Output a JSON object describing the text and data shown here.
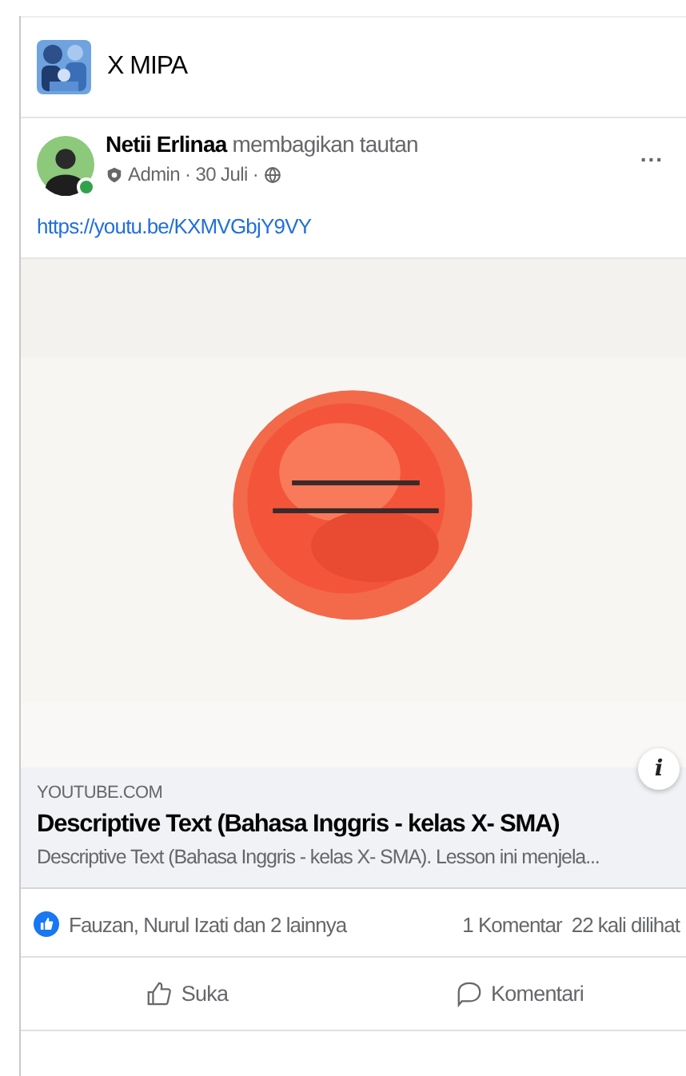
{
  "group": {
    "name": "X MIPA"
  },
  "post": {
    "author": "Netii Erlinaa",
    "action": "membagikan tautan",
    "role": "Admin",
    "date": "30 Juli",
    "separator": "·",
    "online": true,
    "more": "...",
    "link": "https://youtu.be/KXMVGbjY9VY"
  },
  "preview": {
    "domain": "YOUTUBE.COM",
    "title": "Descriptive Text (Bahasa Inggris - kelas X- SMA)",
    "description": "Descriptive Text (Bahasa Inggris - kelas X- SMA). Lesson ini menjela...",
    "info": "i"
  },
  "stats": {
    "reactions": "Fauzan, Nurul Izati dan 2 lainnya",
    "comments": "1 Komentar",
    "views": "22 kali dilihat"
  },
  "actions": [
    {
      "kind": "like",
      "label": "Suka"
    },
    {
      "kind": "comment",
      "label": "Komentari"
    }
  ]
}
